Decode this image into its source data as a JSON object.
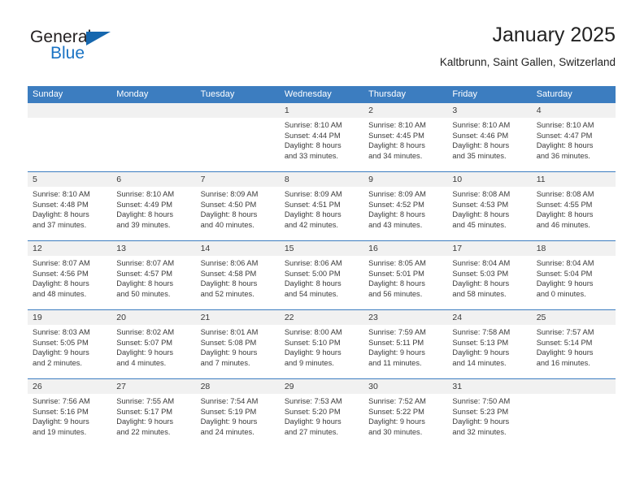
{
  "brand": {
    "word1": "General",
    "word2": "Blue",
    "accent_color": "#1667ae",
    "triangle_icon": "brand-triangle-icon"
  },
  "header": {
    "title": "January 2025",
    "subtitle": "Kaltbrunn, Saint Gallen, Switzerland"
  },
  "theme": {
    "header_bg": "#3c7dc0",
    "daynum_bg": "#f1f1f1",
    "text": "#3a3a3a"
  },
  "weekdays": [
    "Sunday",
    "Monday",
    "Tuesday",
    "Wednesday",
    "Thursday",
    "Friday",
    "Saturday"
  ],
  "labels": {
    "sunrise_prefix": "Sunrise:",
    "sunset_prefix": "Sunset:",
    "daylight_prefix": "Daylight:"
  },
  "weeks": [
    [
      {
        "day": "",
        "blank": true
      },
      {
        "day": "",
        "blank": true
      },
      {
        "day": "",
        "blank": true
      },
      {
        "day": "1",
        "sunrise": "Sunrise: 8:10 AM",
        "sunset": "Sunset: 4:44 PM",
        "daylight1": "Daylight: 8 hours",
        "daylight2": "and 33 minutes."
      },
      {
        "day": "2",
        "sunrise": "Sunrise: 8:10 AM",
        "sunset": "Sunset: 4:45 PM",
        "daylight1": "Daylight: 8 hours",
        "daylight2": "and 34 minutes."
      },
      {
        "day": "3",
        "sunrise": "Sunrise: 8:10 AM",
        "sunset": "Sunset: 4:46 PM",
        "daylight1": "Daylight: 8 hours",
        "daylight2": "and 35 minutes."
      },
      {
        "day": "4",
        "sunrise": "Sunrise: 8:10 AM",
        "sunset": "Sunset: 4:47 PM",
        "daylight1": "Daylight: 8 hours",
        "daylight2": "and 36 minutes."
      }
    ],
    [
      {
        "day": "5",
        "sunrise": "Sunrise: 8:10 AM",
        "sunset": "Sunset: 4:48 PM",
        "daylight1": "Daylight: 8 hours",
        "daylight2": "and 37 minutes."
      },
      {
        "day": "6",
        "sunrise": "Sunrise: 8:10 AM",
        "sunset": "Sunset: 4:49 PM",
        "daylight1": "Daylight: 8 hours",
        "daylight2": "and 39 minutes."
      },
      {
        "day": "7",
        "sunrise": "Sunrise: 8:09 AM",
        "sunset": "Sunset: 4:50 PM",
        "daylight1": "Daylight: 8 hours",
        "daylight2": "and 40 minutes."
      },
      {
        "day": "8",
        "sunrise": "Sunrise: 8:09 AM",
        "sunset": "Sunset: 4:51 PM",
        "daylight1": "Daylight: 8 hours",
        "daylight2": "and 42 minutes."
      },
      {
        "day": "9",
        "sunrise": "Sunrise: 8:09 AM",
        "sunset": "Sunset: 4:52 PM",
        "daylight1": "Daylight: 8 hours",
        "daylight2": "and 43 minutes."
      },
      {
        "day": "10",
        "sunrise": "Sunrise: 8:08 AM",
        "sunset": "Sunset: 4:53 PM",
        "daylight1": "Daylight: 8 hours",
        "daylight2": "and 45 minutes."
      },
      {
        "day": "11",
        "sunrise": "Sunrise: 8:08 AM",
        "sunset": "Sunset: 4:55 PM",
        "daylight1": "Daylight: 8 hours",
        "daylight2": "and 46 minutes."
      }
    ],
    [
      {
        "day": "12",
        "sunrise": "Sunrise: 8:07 AM",
        "sunset": "Sunset: 4:56 PM",
        "daylight1": "Daylight: 8 hours",
        "daylight2": "and 48 minutes."
      },
      {
        "day": "13",
        "sunrise": "Sunrise: 8:07 AM",
        "sunset": "Sunset: 4:57 PM",
        "daylight1": "Daylight: 8 hours",
        "daylight2": "and 50 minutes."
      },
      {
        "day": "14",
        "sunrise": "Sunrise: 8:06 AM",
        "sunset": "Sunset: 4:58 PM",
        "daylight1": "Daylight: 8 hours",
        "daylight2": "and 52 minutes."
      },
      {
        "day": "15",
        "sunrise": "Sunrise: 8:06 AM",
        "sunset": "Sunset: 5:00 PM",
        "daylight1": "Daylight: 8 hours",
        "daylight2": "and 54 minutes."
      },
      {
        "day": "16",
        "sunrise": "Sunrise: 8:05 AM",
        "sunset": "Sunset: 5:01 PM",
        "daylight1": "Daylight: 8 hours",
        "daylight2": "and 56 minutes."
      },
      {
        "day": "17",
        "sunrise": "Sunrise: 8:04 AM",
        "sunset": "Sunset: 5:03 PM",
        "daylight1": "Daylight: 8 hours",
        "daylight2": "and 58 minutes."
      },
      {
        "day": "18",
        "sunrise": "Sunrise: 8:04 AM",
        "sunset": "Sunset: 5:04 PM",
        "daylight1": "Daylight: 9 hours",
        "daylight2": "and 0 minutes."
      }
    ],
    [
      {
        "day": "19",
        "sunrise": "Sunrise: 8:03 AM",
        "sunset": "Sunset: 5:05 PM",
        "daylight1": "Daylight: 9 hours",
        "daylight2": "and 2 minutes."
      },
      {
        "day": "20",
        "sunrise": "Sunrise: 8:02 AM",
        "sunset": "Sunset: 5:07 PM",
        "daylight1": "Daylight: 9 hours",
        "daylight2": "and 4 minutes."
      },
      {
        "day": "21",
        "sunrise": "Sunrise: 8:01 AM",
        "sunset": "Sunset: 5:08 PM",
        "daylight1": "Daylight: 9 hours",
        "daylight2": "and 7 minutes."
      },
      {
        "day": "22",
        "sunrise": "Sunrise: 8:00 AM",
        "sunset": "Sunset: 5:10 PM",
        "daylight1": "Daylight: 9 hours",
        "daylight2": "and 9 minutes."
      },
      {
        "day": "23",
        "sunrise": "Sunrise: 7:59 AM",
        "sunset": "Sunset: 5:11 PM",
        "daylight1": "Daylight: 9 hours",
        "daylight2": "and 11 minutes."
      },
      {
        "day": "24",
        "sunrise": "Sunrise: 7:58 AM",
        "sunset": "Sunset: 5:13 PM",
        "daylight1": "Daylight: 9 hours",
        "daylight2": "and 14 minutes."
      },
      {
        "day": "25",
        "sunrise": "Sunrise: 7:57 AM",
        "sunset": "Sunset: 5:14 PM",
        "daylight1": "Daylight: 9 hours",
        "daylight2": "and 16 minutes."
      }
    ],
    [
      {
        "day": "26",
        "sunrise": "Sunrise: 7:56 AM",
        "sunset": "Sunset: 5:16 PM",
        "daylight1": "Daylight: 9 hours",
        "daylight2": "and 19 minutes."
      },
      {
        "day": "27",
        "sunrise": "Sunrise: 7:55 AM",
        "sunset": "Sunset: 5:17 PM",
        "daylight1": "Daylight: 9 hours",
        "daylight2": "and 22 minutes."
      },
      {
        "day": "28",
        "sunrise": "Sunrise: 7:54 AM",
        "sunset": "Sunset: 5:19 PM",
        "daylight1": "Daylight: 9 hours",
        "daylight2": "and 24 minutes."
      },
      {
        "day": "29",
        "sunrise": "Sunrise: 7:53 AM",
        "sunset": "Sunset: 5:20 PM",
        "daylight1": "Daylight: 9 hours",
        "daylight2": "and 27 minutes."
      },
      {
        "day": "30",
        "sunrise": "Sunrise: 7:52 AM",
        "sunset": "Sunset: 5:22 PM",
        "daylight1": "Daylight: 9 hours",
        "daylight2": "and 30 minutes."
      },
      {
        "day": "31",
        "sunrise": "Sunrise: 7:50 AM",
        "sunset": "Sunset: 5:23 PM",
        "daylight1": "Daylight: 9 hours",
        "daylight2": "and 32 minutes."
      },
      {
        "day": "",
        "blank": true
      }
    ]
  ]
}
